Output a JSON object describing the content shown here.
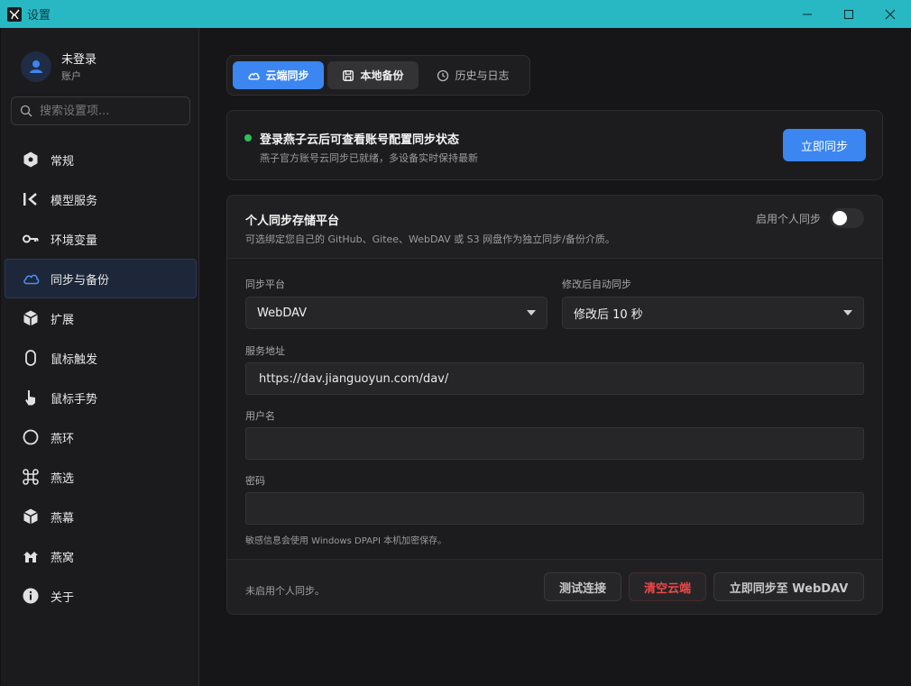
{
  "window": {
    "title": "设置",
    "icons": {
      "app": "app-logo-icon",
      "minimize": "minimize-icon",
      "maximize": "maximize-icon",
      "close": "close-icon"
    }
  },
  "sidebar": {
    "user": {
      "name": "未登录",
      "subtitle": "账户",
      "icon": "user-icon"
    },
    "search": {
      "placeholder": "搜索设置项..."
    },
    "items": [
      {
        "label": "常规",
        "icon": "hexagon-icon"
      },
      {
        "label": "模型服务",
        "icon": "model-service-icon"
      },
      {
        "label": "环境变量",
        "icon": "key-icon"
      },
      {
        "label": "同步与备份",
        "icon": "cloud-icon",
        "active": true
      },
      {
        "label": "扩展",
        "icon": "cube-icon"
      },
      {
        "label": "鼠标触发",
        "icon": "mouse-icon"
      },
      {
        "label": "鼠标手势",
        "icon": "hand-pointer-icon"
      },
      {
        "label": "燕环",
        "icon": "ring-icon"
      },
      {
        "label": "燕选",
        "icon": "command-icon"
      },
      {
        "label": "燕幕",
        "icon": "box-icon"
      },
      {
        "label": "燕窝",
        "icon": "nest-icon"
      },
      {
        "label": "关于",
        "icon": "info-icon"
      }
    ]
  },
  "tabs": [
    {
      "label": "云端同步",
      "icon": "cloud-icon",
      "active": true
    },
    {
      "label": "本地备份",
      "icon": "backup-icon"
    },
    {
      "label": "历史与日志",
      "icon": "clock-icon"
    }
  ],
  "cloud_card": {
    "title": "登录燕子云后可查看账号配置同步状态",
    "subtitle": "燕子官方账号云同步已就绪，多设备实时保持最新",
    "button": "立即同步",
    "status_color": "#2fbf5a"
  },
  "personal": {
    "title": "个人同步存储平台",
    "description": "可选绑定您自己的 GitHub、Gitee、WebDAV 或 S3 网盘作为独立同步/备份介质。",
    "toggle_label": "启用个人同步",
    "toggle_on": false,
    "platform": {
      "label": "同步平台",
      "value": "WebDAV"
    },
    "auto_sync": {
      "label": "修改后自动同步",
      "value": "修改后 10 秒"
    },
    "server": {
      "label": "服务地址",
      "value": "https://dav.jianguoyun.com/dav/"
    },
    "username": {
      "label": "用户名",
      "value": ""
    },
    "password": {
      "label": "密码",
      "value": ""
    },
    "hint": "敏感信息会使用 Windows DPAPI 本机加密保存。",
    "footer_status": "未启用个人同步。",
    "buttons": {
      "test": "测试连接",
      "clear": "清空云端",
      "push": "立即同步至 WebDAV"
    }
  },
  "colors": {
    "accent": "#3b86f0",
    "titlebar": "#28b8c4",
    "danger": "#f04848"
  }
}
